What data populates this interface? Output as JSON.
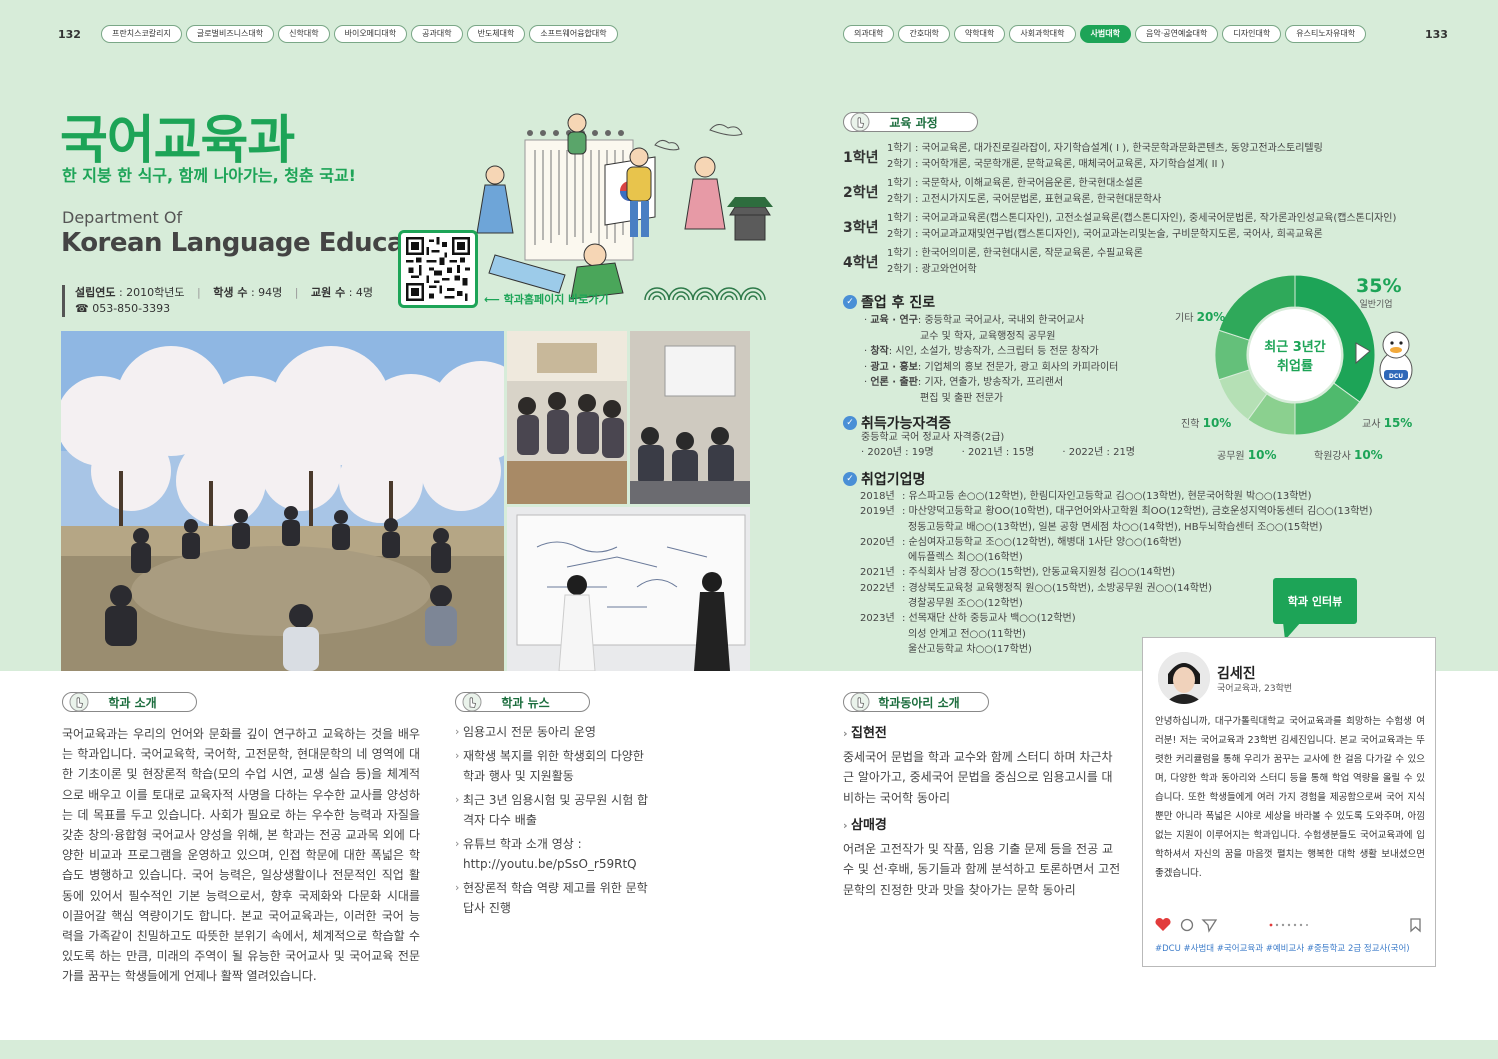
{
  "pages": {
    "left_num": "132",
    "right_num": "133"
  },
  "tabs_left": [
    "프란치스코칼리지",
    "글로벌비즈니스대학",
    "신학대학",
    "바이오메디대학",
    "공과대학",
    "반도체대학",
    "소프트웨어융합대학"
  ],
  "tabs_right": [
    "의과대학",
    "간호대학",
    "약학대학",
    "사회과학대학",
    "사범대학",
    "음악·공연예술대학",
    "디자인대학",
    "유스티노자유대학"
  ],
  "tabs_right_active": 4,
  "dept": {
    "title": "국어교육과",
    "slogan": "한 지붕 한 식구, 함께 나아가는, 청춘 국교!",
    "en_small": "Department Of",
    "en_large": "Korean Language Education",
    "founded_label": "설립연도",
    "founded_value": " : 2010학년도",
    "students_label": "학생 수",
    "students_value": " : 94명",
    "faculty_label": "교원 수",
    "faculty_value": " : 4명",
    "phone": "☎ 053-850-3393",
    "qr_link": "⟵ 학과홈페이지 바로가기"
  },
  "intro": {
    "heading": "학과 소개",
    "text": "국어교육과는 우리의 언어와 문화를 깊이 연구하고 교육하는 것을 배우는 학과입니다. 국어교육학, 국어학, 고전문학, 현대문학의 네 영역에 대한 기초이론 및 현장론적 학습(모의 수업 시연, 교생 실습 등)을 체계적으로 배우고 이를 토대로 교육자적 사명을 다하는 우수한 교사를 양성하는 데 목표를 두고 있습니다. 사회가 필요로 하는 우수한 능력과 자질을 갖춘 창의·융합형 국어교사 양성을 위해, 본 학과는 전공 교과목 외에 다양한 비교과 프로그램을 운영하고 있으며, 인접 학문에 대한 폭넓은 학습도 병행하고 있습니다. 국어 능력은, 일상생활이나 전문적인 직업 활동에 있어서 필수적인 기본 능력으로서, 향후 국제화와 다문화 시대를 이끌어갈 핵심 역량이기도 합니다. 본교 국어교육과는, 이러한 국어 능력을 가족같이 친밀하고도 따뜻한 분위기 속에서, 체계적으로 학습할 수 있도록 하는 만큼, 미래의 주역이 될 유능한 국어교사 및 국어교육 전문가를 꿈꾸는 학생들에게 언제나 활짝 열려있습니다."
  },
  "news": {
    "heading": "학과 뉴스",
    "items": [
      "임용고시 전문 동아리 운영",
      "재학생 복지를 위한 학생회의 다양한 학과 행사 및 지원활동",
      "최근 3년 임용시험 및 공무원 시험 합격자 다수 배출",
      "유튜브 학과 소개 영상 : http://youtu.be/pSsO_r59RtQ",
      "현장론적 학습 역량 제고를 위한 문학 답사 진행"
    ]
  },
  "curriculum": {
    "heading": "교육 과정",
    "years": [
      {
        "year": "1학년",
        "lines": [
          "1학기 : 국어교육론, 대가진로길라잡이, 자기학습설계( I ), 한국문학과문화콘텐츠, 동양고전과스토리텔링",
          "2학기 : 국어학개론, 국문학개론, 문학교육론, 매체국어교육론, 자기학습설계( II )"
        ]
      },
      {
        "year": "2학년",
        "lines": [
          "1학기 : 국문학사, 이해교육론, 한국어음운론, 한국현대소설론",
          "2학기 : 고전시가지도론, 국어문법론, 표현교육론, 한국현대문학사"
        ]
      },
      {
        "year": "3학년",
        "lines": [
          "1학기 : 국어교과교육론(캡스톤디자인), 고전소설교육론(캡스톤디자인), 중세국어문법론, 작가론과인성교육(캡스톤디자인)",
          "2학기 : 국어교과교재및연구법(캡스톤디자인), 국어교과논리및논술, 구비문학지도론, 국어사, 희곡교육론"
        ]
      },
      {
        "year": "4학년",
        "lines": [
          "1학기 : 한국어의미론, 한국현대시론, 작문교육론, 수필교육론",
          "2학기 : 광고와언어학"
        ]
      }
    ]
  },
  "career": {
    "heading": "졸업 후 진로",
    "rows": [
      {
        "key": "교육 · 연구",
        "val": " : 중등학교 국어교사, 국내외 한국어교사"
      },
      {
        "key": "",
        "val": "교수 및 학자, 교육행정직 공무원"
      },
      {
        "key": "창작",
        "val": " : 시인, 소설가, 방송작가, 스크립터 등 전문 창작가"
      },
      {
        "key": "광고 · 홍보",
        "val": " : 기업체의 홍보 전문가, 광고 회사의 카피라이터"
      },
      {
        "key": "언론 · 출판",
        "val": " : 기자, 연출가, 방송작가, 프리랜서"
      },
      {
        "key": "",
        "val": "편집 및 출판 전문가"
      }
    ]
  },
  "cert": {
    "heading": "취득가능자격증",
    "name": "중등학교 국어 정교사 자격증(2급)",
    "years": [
      "· 2020년 : 19명",
      "· 2021년 : 15명",
      "· 2022년 : 21명"
    ]
  },
  "employers": {
    "heading": "취업기업명",
    "rows": [
      {
        "y": "2018년",
        "t": " : 유스파고등 손○○(12학번), 한림디자인고등학교 김○○(13학번), 현문국어학원 박○○(13학번)"
      },
      {
        "y": "2019년",
        "t": " : 마산양덕고등학교 황OO(10학번), 대구언어와사고학원 최OO(12학번), 금호운성지역아동센터 김○○(13학번)"
      },
      {
        "y": "",
        "t": "정동고등학교 배○○(13학번), 일본 공항 면세점 차○○(14학번), HB두뇌학습센터 조○○(15학번)"
      },
      {
        "y": "2020년",
        "t": " : 순심여자고등학교 조○○(12학번), 해병대 1사단 양○○(16학번)"
      },
      {
        "y": "",
        "t": "에듀플렉스 최○○(16학번)"
      },
      {
        "y": "2021년",
        "t": " : 주식회사 남경 장○○(15학번), 안동교육지원청 김○○(14학번)"
      },
      {
        "y": "2022년",
        "t": " : 경상북도교육청 교육행정직 원○○(15학번), 소방공무원 권○○(14학번)"
      },
      {
        "y": "",
        "t": "경찰공무원 조○○(12학번)"
      },
      {
        "y": "2023년",
        "t": " : 선목재단 산하 중등교사 백○○(12학번)"
      },
      {
        "y": "",
        "t": "의성 안계고 전○○(11학번)"
      },
      {
        "y": "",
        "t": "울산고등학교 차○○(17학번)"
      }
    ]
  },
  "employment_chart": {
    "center_label_1": "최근 3년간",
    "center_label_2": "취업률",
    "slices": [
      {
        "name": "일반기업",
        "value": 35,
        "color": "#1da457"
      },
      {
        "name": "교사",
        "value": 15,
        "color": "#4fba6d"
      },
      {
        "name": "학원강사",
        "value": 10,
        "color": "#8bd08f"
      },
      {
        "name": "공무원",
        "value": 10,
        "color": "#b5e0b5"
      },
      {
        "name": "진학",
        "value": 10,
        "color": "#64c07a"
      },
      {
        "name": "기타",
        "value": 20,
        "color": "#2fa95a"
      }
    ],
    "labels": {
      "corp_pct": "35%",
      "corp_name": "일반기업",
      "etc_name": "기타 ",
      "etc_pct": "20%",
      "teacher_name": "교사 ",
      "teacher_pct": "15%",
      "academy_name": "학원강사 ",
      "academy_pct": "10%",
      "civil_name": "공무원 ",
      "civil_pct": "10%",
      "grad_name": "진학 ",
      "grad_pct": "10%"
    },
    "mascot_badge": "DCU"
  },
  "clubs": {
    "heading": "학과동아리 소개",
    "items": [
      {
        "name": "집현전",
        "desc": "중세국어 문법을 학과 교수와 함께 스터디 하며 차근차근 알아가고, 중세국어 문법을 중심으로 임용고시를 대비하는 국어학 동아리"
      },
      {
        "name": "삼매경",
        "desc": "어려운 고전작가 및 작품, 임용 기출 문제 등을 전공 교수 및 선·후배, 동기들과 함께 분석하고 토론하면서 고전 문학의 진정한 맛과 맛을 찾아가는 문학 동아리"
      }
    ]
  },
  "interview": {
    "tag": "학과 인터뷰",
    "name": "김세진",
    "sub": "국어교육과, 23학번",
    "text": "안녕하십니까, 대구가톨릭대학교 국어교육과를 희망하는 수험생 여러분! 저는 국어교육과 23학번 김세진입니다. 본교 국어교육과는 뚜렷한 커리큘럼을 통해 우리가 꿈꾸는 교사에 한 걸음 다가갈 수 있으며, 다양한 학과 동아리와 스터디 등을 통해 학업 역량을 올릴 수 있습니다. 또한 학생들에게 여러 가지 경험을 제공함으로써 국어 지식뿐만 아니라 폭넓은 시야로 세상을 바라볼 수 있도록 도와주며, 아낌없는 지원이 이루어지는 학과입니다. 수험생분들도 국어교육과에 입학하셔서 자신의 꿈을 마음껏 펼치는 행복한 대학 생활 보내셨으면 좋겠습니다.",
    "tags": "#DCU #사범대 #국어교육과 #예비교사 #중등학교 2급 정교사(국어)"
  }
}
